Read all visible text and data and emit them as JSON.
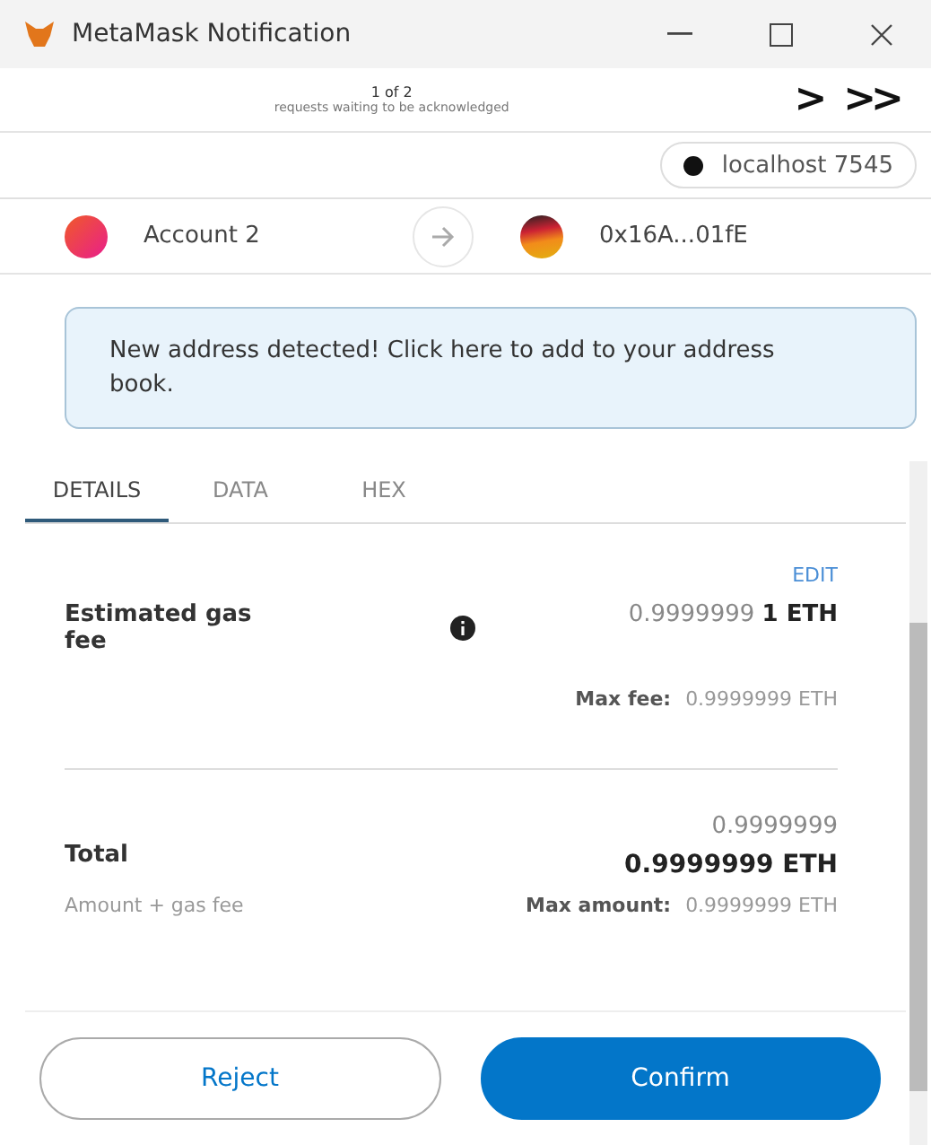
{
  "window": {
    "title": "MetaMask Notification"
  },
  "requests": {
    "count": "1 of 2",
    "caption": "requests waiting to be acknowledged",
    "next": ">",
    "last": ">>"
  },
  "network": {
    "name": "localhost 7545"
  },
  "accounts": {
    "from": "Account 2",
    "to": "0x16A...01fE"
  },
  "notice": "New address detected! Click here to add to your address book.",
  "tabs": [
    {
      "label": "DETAILS",
      "selected": true
    },
    {
      "label": "DATA",
      "selected": false
    },
    {
      "label": "HEX",
      "selected": false
    }
  ],
  "edit": "EDIT",
  "gas": {
    "label": "Estimated gas fee",
    "value": "0.9999999",
    "value_bold": "1 ETH",
    "max_label": "Max fee:",
    "max_value": "0.9999999 ETH"
  },
  "total": {
    "label": "Total",
    "value": "0.9999999",
    "value_bold": "0.9999999 ETH",
    "sub_label": "Amount + gas fee",
    "max_label": "Max amount:",
    "max_value": "0.9999999 ETH"
  },
  "buttons": [
    {
      "label": "Reject",
      "kind": "secondary"
    },
    {
      "label": "Confirm",
      "kind": "primary"
    }
  ]
}
